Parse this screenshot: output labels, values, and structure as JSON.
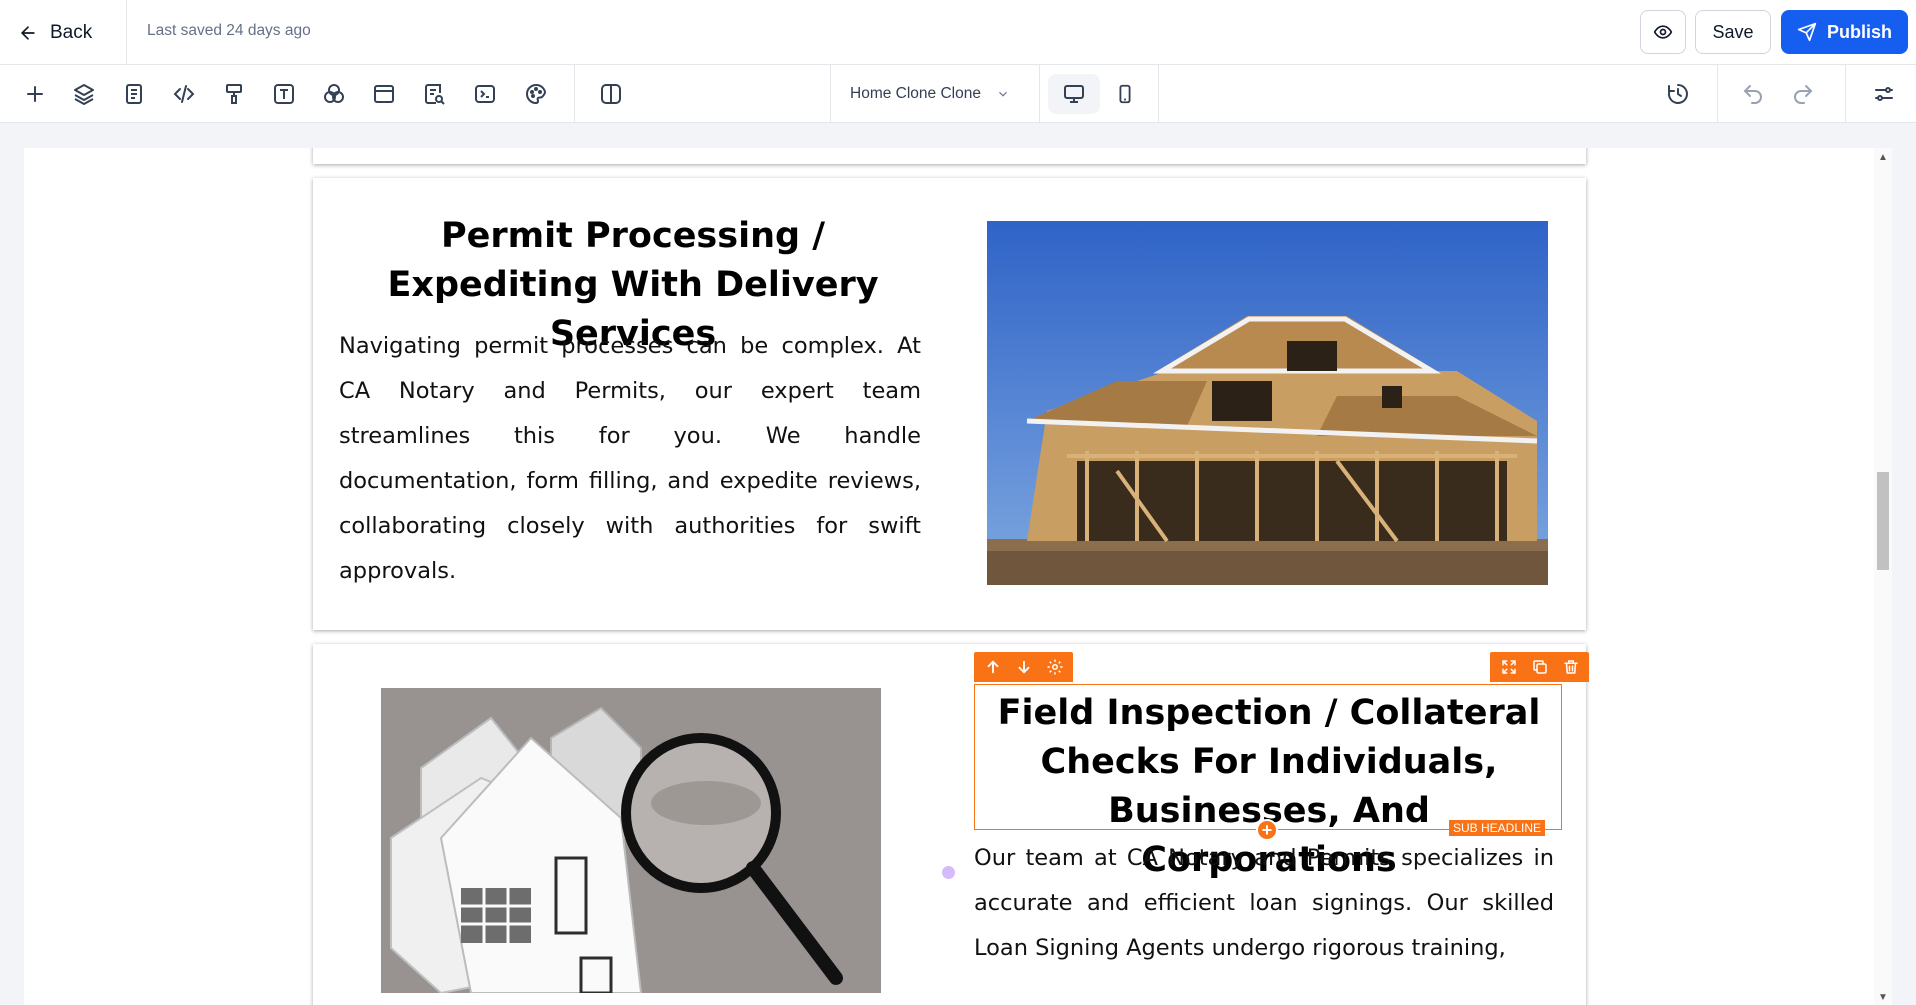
{
  "topbar": {
    "back_label": "Back",
    "last_saved": "Last saved 24 days ago",
    "save_label": "Save",
    "publish_label": "Publish"
  },
  "toolbar": {
    "icons": [
      "plus-icon",
      "layers-icon",
      "page-icon",
      "code-icon",
      "paint-roller-icon",
      "text-icon",
      "shapes-icon",
      "section-icon",
      "search-doc-icon",
      "terminal-icon",
      "palette-icon",
      "split-view-icon"
    ],
    "page_selector": "Home Clone Clone",
    "device": "desktop"
  },
  "canvas": {
    "section1": {
      "headline": "Permit Processing / Expediting With Delivery Services",
      "paragraph": "Navigating permit processes can be complex. At CA Notary and Permits, our expert team streamlines this for you. We handle documentation, form filling, and expedite reviews, collaborating closely with authorities for swift approvals.",
      "image": "house-under-construction"
    },
    "section2": {
      "headline": "Field Inspection / Collateral Checks For Individuals, Businesses, And Corporations",
      "paragraph": "Our team at CA Notary and Permits specializes in accurate and efficient loan signings. Our skilled Loan Signing Agents undergo rigorous training,",
      "image": "paper-houses-magnifier",
      "selected_tag": "SUB HEADLINE",
      "accent": "#f97316"
    }
  },
  "colors": {
    "publish": "#155eef",
    "selection": "#f97316"
  }
}
